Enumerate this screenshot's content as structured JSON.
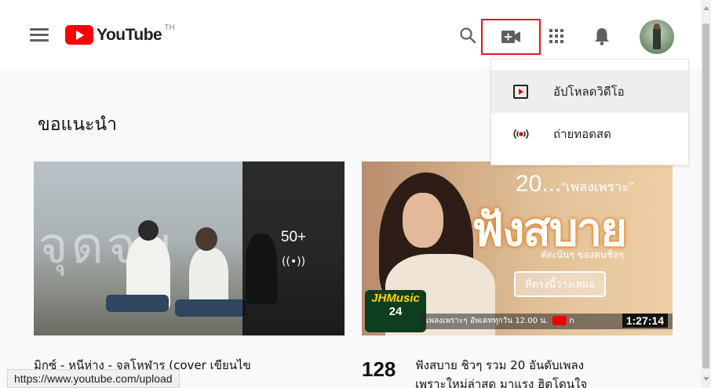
{
  "header": {
    "logo_text": "YouTube",
    "region": "TH",
    "icons": [
      "menu-icon",
      "search-icon",
      "video-camera-plus-icon",
      "apps-grid-icon",
      "bell-icon",
      "avatar"
    ]
  },
  "create_menu": {
    "items": [
      {
        "label": "อัปโหลดวิดีโอ",
        "icon": "upload-play-icon"
      },
      {
        "label": "ถ่ายทอดสด",
        "icon": "live-broadcast-icon"
      }
    ]
  },
  "section": {
    "title": "ขอแนะนำ"
  },
  "videos": [
    {
      "thumb_text": "จุดจบ",
      "overlay_count": "50+",
      "overlay_icon": "((•))",
      "title_line1": "มิกซ์ - หนีห่าง - จุลโหฬาร (cover เขียนไข"
    },
    {
      "heading_main": "20...",
      "heading_quote": "“เพลงเพราะ”",
      "title_art": "ฟังสบาย",
      "subtitle": "คัดเน้นๆ ของคนชิลๆ",
      "pill_text": "ที่ตรงนี้ว่างเสมอ",
      "logo_l1": "JHMusic",
      "logo_l2": "24",
      "bar_text": "เพลงเพราะๆ อัพเดททุกวัน 12.00 น.",
      "bar_suffix": "n",
      "duration": "1:27:14",
      "channel_badge": "128",
      "title_line1": "ฟังสบาย ชิวๆ รวม 20 อันดับเพลง",
      "title_line2": "เพราะใหม่ล่าสุด มาแรง ฮิตโดนใจ"
    }
  ],
  "status_bar": {
    "url": "https://www.youtube.com/upload"
  },
  "colors": {
    "brand_red": "#ff0000",
    "highlight_border": "#e0191f",
    "icon_gray": "#606060"
  }
}
